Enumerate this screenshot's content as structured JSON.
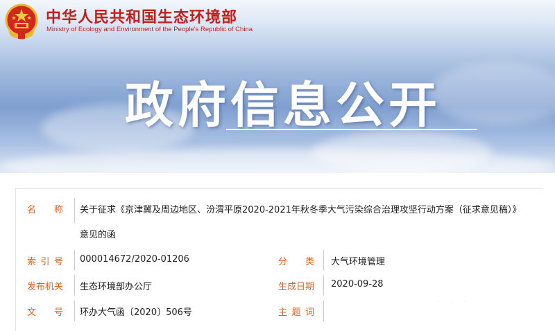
{
  "header": {
    "ministry_cn": "中华人民共和国生态环境部",
    "ministry_en": "Ministry of Ecology and Environment of the People's Republic of China",
    "emblem_icon": "national-emblem-icon",
    "banner_title": "政府信息公开"
  },
  "colors": {
    "brand_red": "#c3201c",
    "label_orange": "#e0601a",
    "banner_blue": "#7f9fd0"
  },
  "info": {
    "name_label": "名  称",
    "name_value_line1": "关于征求《京津冀及周边地区、汾渭平原2020-2021年秋冬季大气污染综合治理攻坚行动方案（征求意见稿）》",
    "name_value_line2": "意见的函",
    "index_label": "索 引 号",
    "index_value": "000014672/2020-01206",
    "category_label": "分  类",
    "category_value": "大气环境管理",
    "publisher_label": "发布机关",
    "publisher_value": "生态环境部办公厅",
    "date_label": "生成日期",
    "date_value": "2020-09-28",
    "doc_no_label": "文  号",
    "doc_no_value": "环办大气函〔2020〕506号",
    "subject_label": "主 题 词",
    "subject_value": ""
  }
}
